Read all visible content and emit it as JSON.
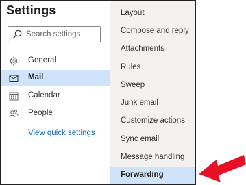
{
  "left": {
    "title": "Settings",
    "search": {
      "placeholder": "Search settings"
    },
    "nav": [
      {
        "label": "General",
        "icon": "gear-icon"
      },
      {
        "label": "Mail",
        "icon": "mail-icon",
        "selected": true
      },
      {
        "label": "Calendar",
        "icon": "calendar-icon"
      },
      {
        "label": "People",
        "icon": "people-icon"
      }
    ],
    "quick_link": "View quick settings"
  },
  "right": {
    "items": [
      "Layout",
      "Compose and reply",
      "Attachments",
      "Rules",
      "Sweep",
      "Junk email",
      "Customize actions",
      "Sync email",
      "Message handling",
      "Forwarding"
    ],
    "selected_index": 9
  },
  "colors": {
    "selected_bg": "#cfe4fa",
    "link": "#0f6cbd",
    "annotation_arrow": "#e81123"
  }
}
